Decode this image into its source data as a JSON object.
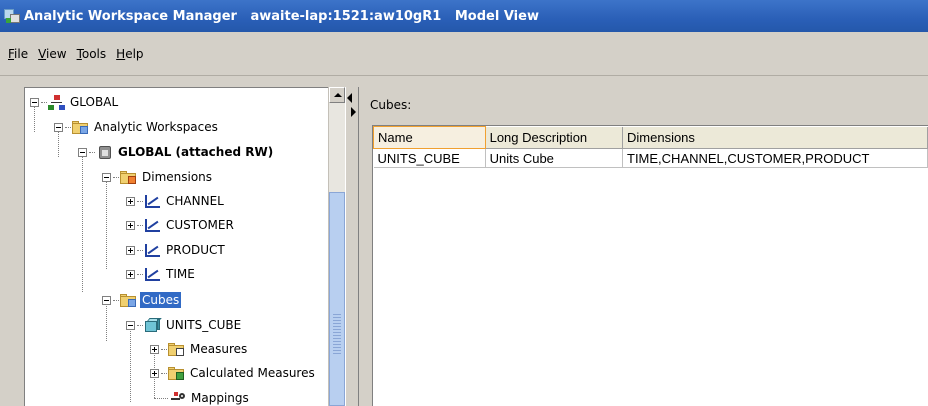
{
  "window": {
    "title": "Analytic Workspace Manager   awaite-lap:1521:aw10gR1   Model View"
  },
  "menu": [
    {
      "label": "File",
      "mnemonic": "F",
      "rest": "ile"
    },
    {
      "label": "View",
      "mnemonic": "V",
      "rest": "iew"
    },
    {
      "label": "Tools",
      "mnemonic": "T",
      "rest": "ools"
    },
    {
      "label": "Help",
      "mnemonic": "H",
      "rest": "elp"
    }
  ],
  "tree": {
    "root": "GLOBAL",
    "analytic_workspaces": "Analytic Workspaces",
    "workspace": "GLOBAL (attached RW)",
    "dimensions": "Dimensions",
    "dimension_items": [
      "CHANNEL",
      "CUSTOMER",
      "PRODUCT",
      "TIME"
    ],
    "cubes": "Cubes",
    "cube": "UNITS_CUBE",
    "measures": "Measures",
    "calculated_measures": "Calculated Measures",
    "mappings": "Mappings",
    "selected": "Cubes"
  },
  "content": {
    "heading": "Cubes:",
    "columns": [
      "Name",
      "Long Description",
      "Dimensions"
    ],
    "rows": [
      [
        "UNITS_CUBE",
        "Units Cube",
        "TIME,CHANNEL,CUSTOMER,PRODUCT"
      ]
    ]
  }
}
